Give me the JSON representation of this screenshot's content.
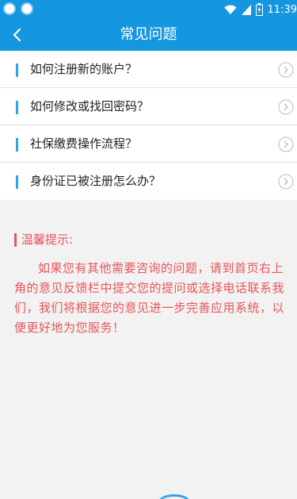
{
  "status_bar": {
    "time": "11:39",
    "icons": [
      "app-icon-1",
      "app-icon-2",
      "wifi-icon",
      "signal-icon",
      "battery-charging-icon"
    ]
  },
  "header": {
    "title": "常见问题",
    "back_icon": "chevron-left-icon",
    "background_color": "#1596e0"
  },
  "faq": {
    "items": [
      {
        "label": "如何注册新的账户？"
      },
      {
        "label": "如何修改或找回密码？"
      },
      {
        "label": "社保缴费操作流程？"
      },
      {
        "label": "身份证已被注册怎么办？"
      }
    ],
    "accent_color": "#2aa6e8",
    "item_icon": "chevron-right-circle-icon"
  },
  "tips": {
    "title": "温馨提示:",
    "body": "如果您有其他需要咨询的问题，请到首页右上角的意见反馈栏中提交您的提问或选择电话联系我们，我们将根据您的意见进一步完善应用系统，以便更好地为您服务！",
    "color": "#e8555a"
  }
}
